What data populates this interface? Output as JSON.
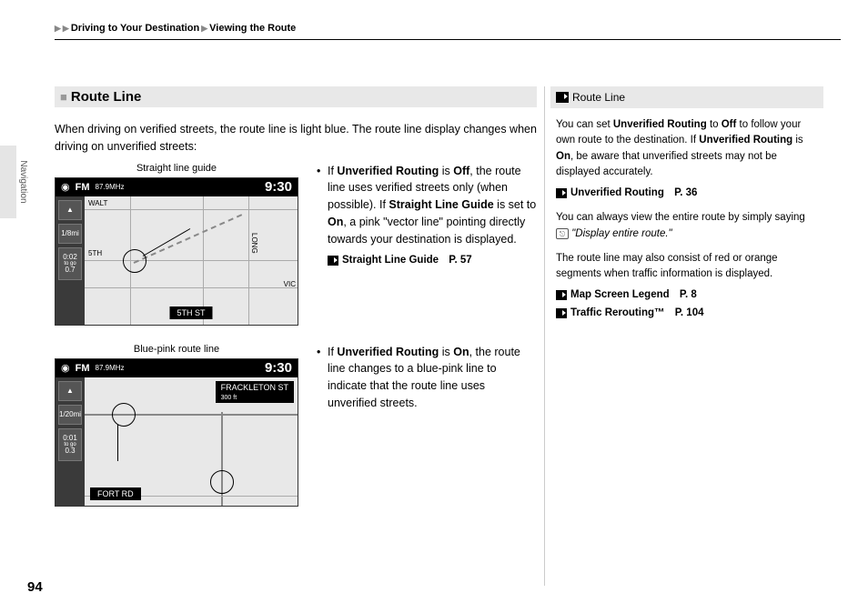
{
  "breadcrumb": {
    "part1": "Driving to Your Destination",
    "part2": "Viewing the Route"
  },
  "sideTab": "Navigation",
  "pageNumber": "94",
  "heading": "Route Line",
  "intro": "When driving on verified streets, the route line is light blue. The route line display changes when driving on unverified streets:",
  "shot1": {
    "caption": "Straight line guide",
    "fm": "FM",
    "freq": "87.9MHz",
    "clock": "9:30",
    "range": "1/8mi",
    "togo": "to go",
    "dist": "0.7",
    "eta": "0:02",
    "street_top": "WALT",
    "street_side": "LONG",
    "street_right": "VIC",
    "street_mid": "5TH",
    "sign": "5TH ST"
  },
  "shot2": {
    "caption": "Blue-pink route line",
    "fm": "FM",
    "freq": "87.9MHz",
    "clock": "9:30",
    "range": "1/20mi",
    "togo": "to go",
    "dist": "0.3",
    "eta": "0:01",
    "sign_top": "FRACKLETON ST",
    "sub": "300 ft",
    "sign_bottom": "FORT RD"
  },
  "bullet1": {
    "text_pre": "If ",
    "b1": "Unverified Routing",
    "t2": " is ",
    "b2": "Off",
    "t3": ", the route line uses verified streets only (when possible). If ",
    "b3": "Straight Line Guide",
    "t4": " is set to ",
    "b4": "On",
    "t5": ", a pink \"vector line\" pointing directly towards your destination is displayed.",
    "xref": "Straight Line Guide",
    "xref_page": "P. 57"
  },
  "bullet2": {
    "text_pre": "If ",
    "b1": "Unverified Routing",
    "t2": " is ",
    "b2": "On",
    "t3": ", the route line changes to a blue-pink line to indicate that the route line uses unverified streets."
  },
  "aside": {
    "heading": "Route Line",
    "p1a": "You can set ",
    "p1b": "Unverified Routing",
    "p1c": " to ",
    "p1d": "Off",
    "p1e": " to follow your own route to the destination. If ",
    "p1f": "Unverified Routing",
    "p1g": " is ",
    "p1h": "On",
    "p1i": ", be aware that unverified streets may not be displayed accurately.",
    "xref1": "Unverified Routing",
    "xref1_page": "P. 36",
    "p2a": "You can always view the entire route by simply saying ",
    "p2b": "\"Display entire route.\"",
    "p3": "The route line may also consist of red or orange segments when traffic information is displayed.",
    "xref2": "Map Screen Legend",
    "xref2_page": "P. 8",
    "xref3": "Traffic Rerouting™",
    "xref3_page": "P. 104"
  }
}
